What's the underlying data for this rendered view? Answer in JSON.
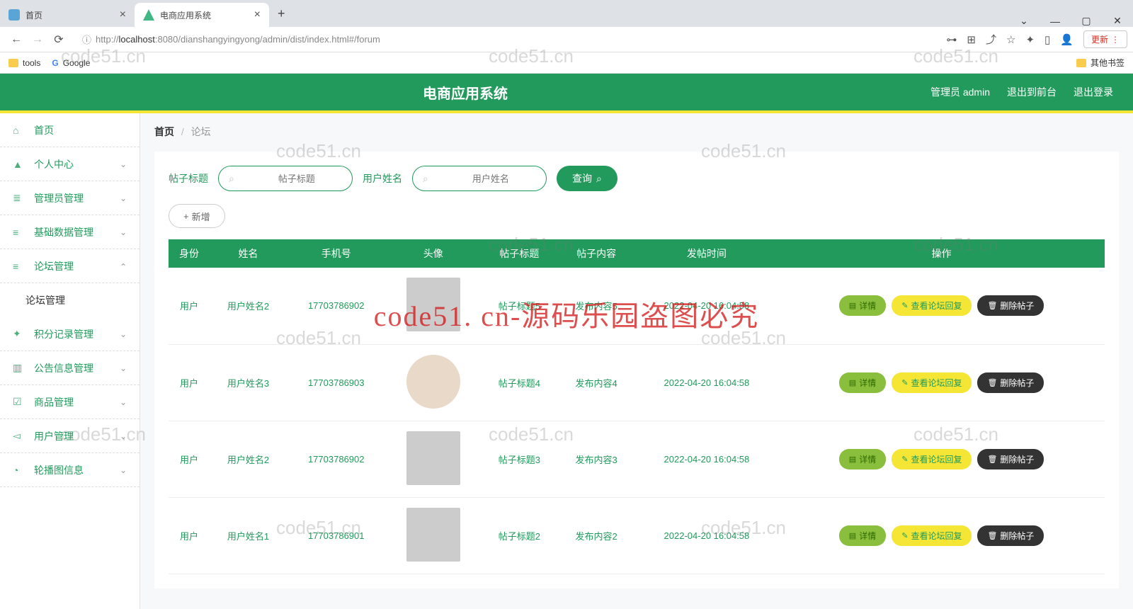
{
  "browser": {
    "tabs": [
      {
        "label": "首页",
        "icon_color": "#5aa5d6"
      },
      {
        "label": "电商应用系统",
        "icon_color": "#41b883"
      }
    ],
    "url_host": "localhost",
    "url_port": ":8080",
    "url_path": "/dianshangyingyong/admin/dist/index.html#/forum",
    "url_prefix": "http://",
    "update_label": "更新",
    "bookmarks": [
      "tools",
      "Google"
    ],
    "other_bookmarks": "其他书签",
    "window_controls": {
      "dropdown": "⌄",
      "minimize": "—",
      "maximize": "▢",
      "close": "✕"
    }
  },
  "app": {
    "title": "电商应用系统",
    "header_links": {
      "admin": "管理员 admin",
      "front": "退出到前台",
      "logout": "退出登录"
    }
  },
  "sidebar": {
    "items": [
      {
        "icon": "⌂",
        "label": "首页",
        "has_children": false
      },
      {
        "icon": "▲",
        "label": "个人中心",
        "has_children": true,
        "open": false
      },
      {
        "icon": "≣",
        "label": "管理员管理",
        "has_children": true,
        "open": false
      },
      {
        "icon": "≡",
        "label": "基础数据管理",
        "has_children": true,
        "open": false
      },
      {
        "icon": "≡",
        "label": "论坛管理",
        "has_children": true,
        "open": true
      },
      {
        "icon": "✦",
        "label": "积分记录管理",
        "has_children": true,
        "open": false
      },
      {
        "icon": "▥",
        "label": "公告信息管理",
        "has_children": true,
        "open": false
      },
      {
        "icon": "☑",
        "label": "商品管理",
        "has_children": true,
        "open": false
      },
      {
        "icon": "◅",
        "label": "用户管理",
        "has_children": true,
        "open": false
      },
      {
        "icon": "◔",
        "label": "轮播图信息",
        "has_children": true,
        "open": false
      }
    ],
    "sub_item": "论坛管理"
  },
  "breadcrumb": {
    "home": "首页",
    "sep": "/",
    "current": "论坛"
  },
  "search": {
    "label1": "帖子标题",
    "placeholder1": "帖子标题",
    "label2": "用户姓名",
    "placeholder2": "用户姓名",
    "query_btn": "查询",
    "add_btn": "新增"
  },
  "table": {
    "headers": [
      "身份",
      "姓名",
      "手机号",
      "头像",
      "帖子标题",
      "帖子内容",
      "发帖时间",
      "操作"
    ],
    "actions": {
      "detail": "详情",
      "reply": "查看论坛回复",
      "delete": "删除帖子"
    },
    "rows": [
      {
        "role": "用户",
        "name": "用户姓名2",
        "phone": "17703786902",
        "avatar_shape": "square",
        "title": "帖子标题5",
        "content": "发布内容5",
        "time": "2022-04-20 16:04:58"
      },
      {
        "role": "用户",
        "name": "用户姓名3",
        "phone": "17703786903",
        "avatar_shape": "circle",
        "title": "帖子标题4",
        "content": "发布内容4",
        "time": "2022-04-20 16:04:58"
      },
      {
        "role": "用户",
        "name": "用户姓名2",
        "phone": "17703786902",
        "avatar_shape": "square",
        "title": "帖子标题3",
        "content": "发布内容3",
        "time": "2022-04-20 16:04:58"
      },
      {
        "role": "用户",
        "name": "用户姓名1",
        "phone": "17703786901",
        "avatar_shape": "square",
        "title": "帖子标题2",
        "content": "发布内容2",
        "time": "2022-04-20 16:04:58"
      }
    ]
  },
  "watermark": {
    "text": "code51.cn",
    "main": "code51. cn-源码乐园盗图必究"
  }
}
